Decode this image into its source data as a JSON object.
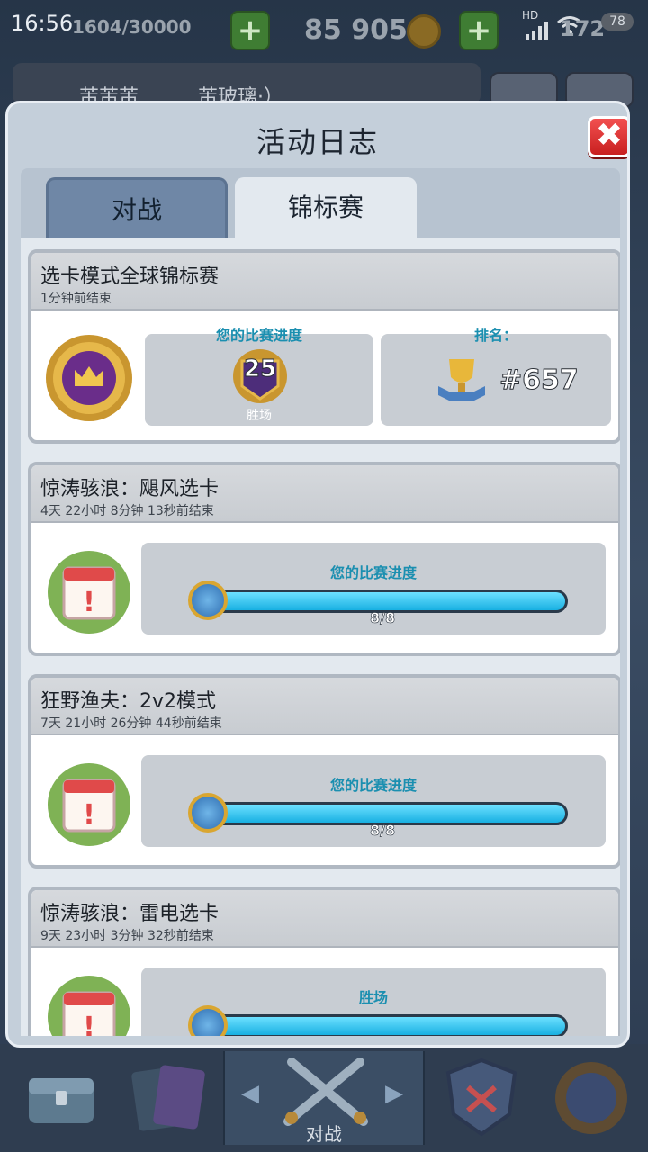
{
  "status_bar": {
    "time": "16:56",
    "trophy_progress": "1604/30000",
    "gold": "85 905",
    "gems": "172",
    "battery": "78",
    "network": "HD"
  },
  "profile": {
    "name": "芾芾芾",
    "clan": "芾玻璃·）"
  },
  "modal": {
    "title": "活动日志",
    "tabs": [
      {
        "label": "对战",
        "active": false
      },
      {
        "label": "锦标赛",
        "active": true
      }
    ]
  },
  "entries": [
    {
      "title": "选卡模式全球锦标赛",
      "subtitle": "1分钟前结束",
      "progress_label": "您的比赛进度",
      "wins": "25",
      "wins_label": "胜场",
      "rank_label": "排名：",
      "rank": "#657"
    },
    {
      "title": "惊涛骇浪：飓风选卡",
      "subtitle": "4天 22小时 8分钟 13秒前结束",
      "progress_label": "您的比赛进度",
      "progress_text": "8/8",
      "progress_fraction": 1.0
    },
    {
      "title": "狂野渔夫：2v2模式",
      "subtitle": "7天 21小时 26分钟 44秒前结束",
      "progress_label": "您的比赛进度",
      "progress_text": "8/8",
      "progress_fraction": 1.0
    },
    {
      "title": "惊涛骇浪：雷电选卡",
      "subtitle": "9天 23小时 3分钟 32秒前结束",
      "progress_label": "胜场",
      "progress_fraction": 1.0
    }
  ],
  "bottom_nav": {
    "active_label": "对战"
  },
  "colors": {
    "modal_bg": "#c4cfda",
    "accent_text": "#1b8fb0",
    "progress_fill": "#18b0e2",
    "close_button": "#e03030"
  }
}
